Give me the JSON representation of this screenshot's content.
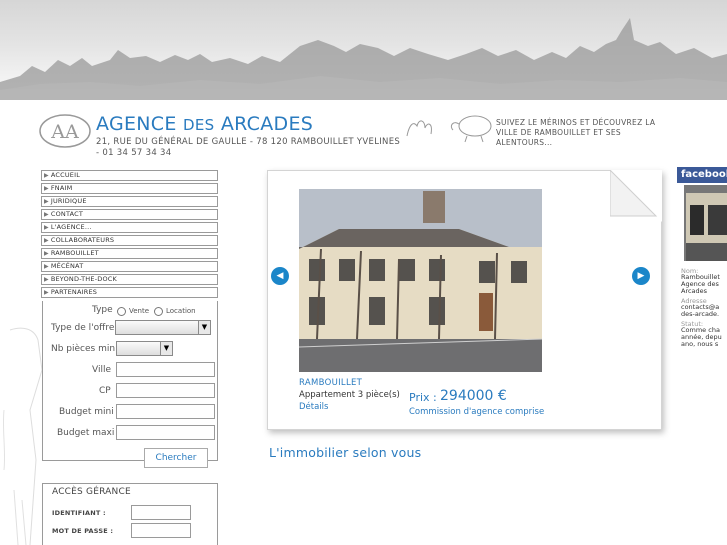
{
  "header": {
    "logo_mark": "AA",
    "logo_agence": "AGENCE",
    "logo_des": "DES",
    "logo_arcades": "ARCADES",
    "address": "21, RUE DU GÉNÉRAL DE GAULLE - 78 120 RAMBOUILLET YVELINES - 01 34 57 34 34",
    "merinos_text": "SUIVEZ LE MÉRINOS ET DÉCOUVREZ LA VILLE DE RAMBOUILLET ET SES ALENTOURS..."
  },
  "menu": {
    "items": [
      "ACCUEIL",
      "FNAIM",
      "JURIDIQUE",
      "CONTACT",
      "L'AGENCE...",
      "COLLABORATEURS",
      "RAMBOUILLET",
      "MÉCÉNAT",
      "BEYOND-THE-DOCK",
      "PARTENAIRES"
    ]
  },
  "search": {
    "type_label": "Type",
    "type_options": [
      "Vente",
      "Location"
    ],
    "offer_label": "Type de l'offre",
    "rooms_label": "Nb pièces min",
    "city_label": "Ville",
    "cp_label": "CP",
    "budget_min_label": "Budget mini",
    "budget_max_label": "Budget maxi",
    "button": "Chercher"
  },
  "gerance": {
    "title": "ACCÈS GÉRANCE",
    "id_label": "IDENTIFIANT :",
    "password_label": "MOT DE PASSE :"
  },
  "featured": {
    "city": "RAMBOUILLET",
    "type": "Appartement 3 pièce(s)",
    "details": "Détails",
    "price_label": "Prix :",
    "price_value": "294000 €",
    "commission": "Commission d'agence comprise",
    "prev_icon": "◀",
    "next_icon": "▶"
  },
  "tagline": "L'immobilier selon vous",
  "facebook": {
    "header": "facebook",
    "name_label": "Nom:",
    "name_value_1": "Rambouillet",
    "name_value_2": "Agence des",
    "name_value_3": "Arcades",
    "address_label": "Adresse",
    "address_value_1": "contacts@a",
    "address_value_2": "des-arcade.",
    "status_label": "Statut:",
    "status_value_1": "Comme cha",
    "status_value_2": "année, depu",
    "status_value_3": "ano, nous s"
  },
  "colors": {
    "accent": "#2a7bbf",
    "nav_arrow": "#1b86c9",
    "facebook": "#3b5998"
  }
}
